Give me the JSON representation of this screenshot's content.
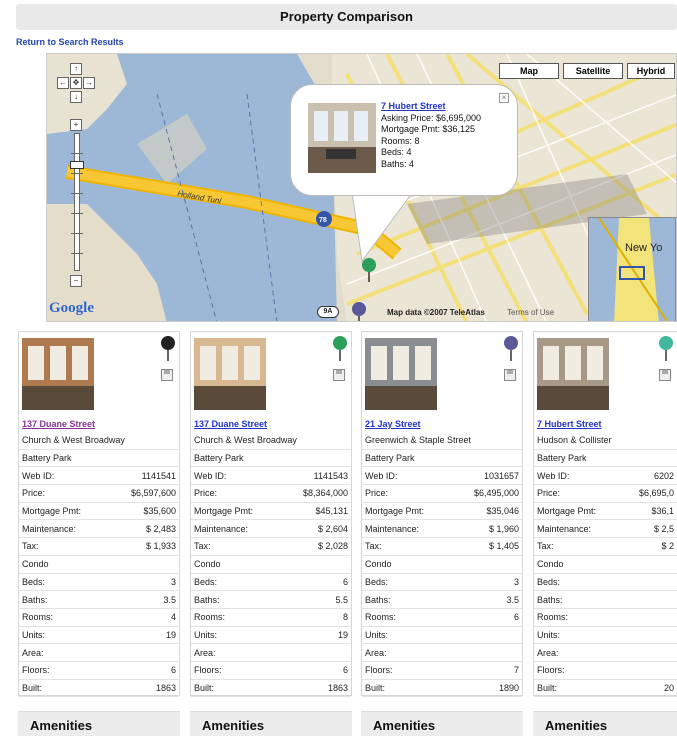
{
  "page": {
    "title": "Property Comparison",
    "return_link": "Return to Search Results"
  },
  "map": {
    "buttons": [
      "Map",
      "Satellite",
      "Hybrid"
    ],
    "labels": {
      "holland": "Holland Tunl",
      "new_york": "New Yo",
      "map_data": "Map data ©2007 TeleAtlas",
      "terms": "Terms of Use",
      "shield": "9A",
      "interstate": "78"
    },
    "logo": "Google",
    "balloon": {
      "address": "7 Hubert Street",
      "lines": [
        "Asking Price: $6,695,000",
        "Mortgage Pmt: $36,125",
        "Rooms: 8",
        "Beds: 4",
        "Baths: 4"
      ],
      "close": "×"
    }
  },
  "listings": [
    {
      "address": "137 Duane Street",
      "visited": true,
      "pin_color": "#222222",
      "lines": [
        "Church & West Broadway",
        "Battery Park"
      ],
      "fields": [
        [
          "Web ID:",
          "1141541"
        ],
        [
          "Price:",
          "$6,597,600"
        ],
        [
          "Mortgage Pmt:",
          "$35,600"
        ],
        [
          "Maintenance:",
          "$ 2,483"
        ],
        [
          "Tax:",
          "$ 1,933"
        ],
        [
          "Condo",
          ""
        ],
        [
          "Beds:",
          "3"
        ],
        [
          "Baths:",
          "3.5"
        ],
        [
          "Rooms:",
          "4"
        ],
        [
          "Units:",
          "19"
        ],
        [
          "Area:",
          ""
        ],
        [
          "Floors:",
          "6"
        ],
        [
          "Built:",
          "1863"
        ]
      ]
    },
    {
      "address": "137 Duane Street",
      "visited": false,
      "pin_color": "#2aa05a",
      "lines": [
        "Church & West Broadway",
        "Battery Park"
      ],
      "fields": [
        [
          "Web ID:",
          "1141543"
        ],
        [
          "Price:",
          "$8,364,000"
        ],
        [
          "Mortgage Pmt:",
          "$45,131"
        ],
        [
          "Maintenance:",
          "$ 2,604"
        ],
        [
          "Tax:",
          "$ 2,028"
        ],
        [
          "Condo",
          ""
        ],
        [
          "Beds:",
          "6"
        ],
        [
          "Baths:",
          "5.5"
        ],
        [
          "Rooms:",
          "8"
        ],
        [
          "Units:",
          "19"
        ],
        [
          "Area:",
          ""
        ],
        [
          "Floors:",
          "6"
        ],
        [
          "Built:",
          "1863"
        ]
      ]
    },
    {
      "address": "21 Jay Street",
      "visited": false,
      "pin_color": "#5a5a9a",
      "lines": [
        "Greenwich & Staple Street",
        "Battery Park"
      ],
      "fields": [
        [
          "Web ID:",
          "1031657"
        ],
        [
          "Price:",
          "$6,495,000"
        ],
        [
          "Mortgage Pmt:",
          "$35,046"
        ],
        [
          "Maintenance:",
          "$ 1,960"
        ],
        [
          "Tax:",
          "$ 1,405"
        ],
        [
          "Condo",
          ""
        ],
        [
          "Beds:",
          "3"
        ],
        [
          "Baths:",
          "3.5"
        ],
        [
          "Rooms:",
          "6"
        ],
        [
          "Units:",
          ""
        ],
        [
          "Area:",
          ""
        ],
        [
          "Floors:",
          "7"
        ],
        [
          "Built:",
          "1890"
        ]
      ]
    },
    {
      "address": "7 Hubert Street",
      "visited": false,
      "pin_color": "#3fb8a0",
      "lines": [
        "Hudson & Collister",
        "Battery Park"
      ],
      "fields": [
        [
          "Web ID:",
          "6202"
        ],
        [
          "Price:",
          "$6,695,0"
        ],
        [
          "Mortgage Pmt:",
          "$36,1"
        ],
        [
          "Maintenance:",
          "$ 2,5"
        ],
        [
          "Tax:",
          "$ 2"
        ],
        [
          "Condo",
          ""
        ],
        [
          "Beds:",
          ""
        ],
        [
          "Baths:",
          ""
        ],
        [
          "Rooms:",
          ""
        ],
        [
          "Units:",
          ""
        ],
        [
          "Area:",
          ""
        ],
        [
          "Floors:",
          ""
        ],
        [
          "Built:",
          "20"
        ]
      ]
    }
  ],
  "amenities_label": "Amenities"
}
